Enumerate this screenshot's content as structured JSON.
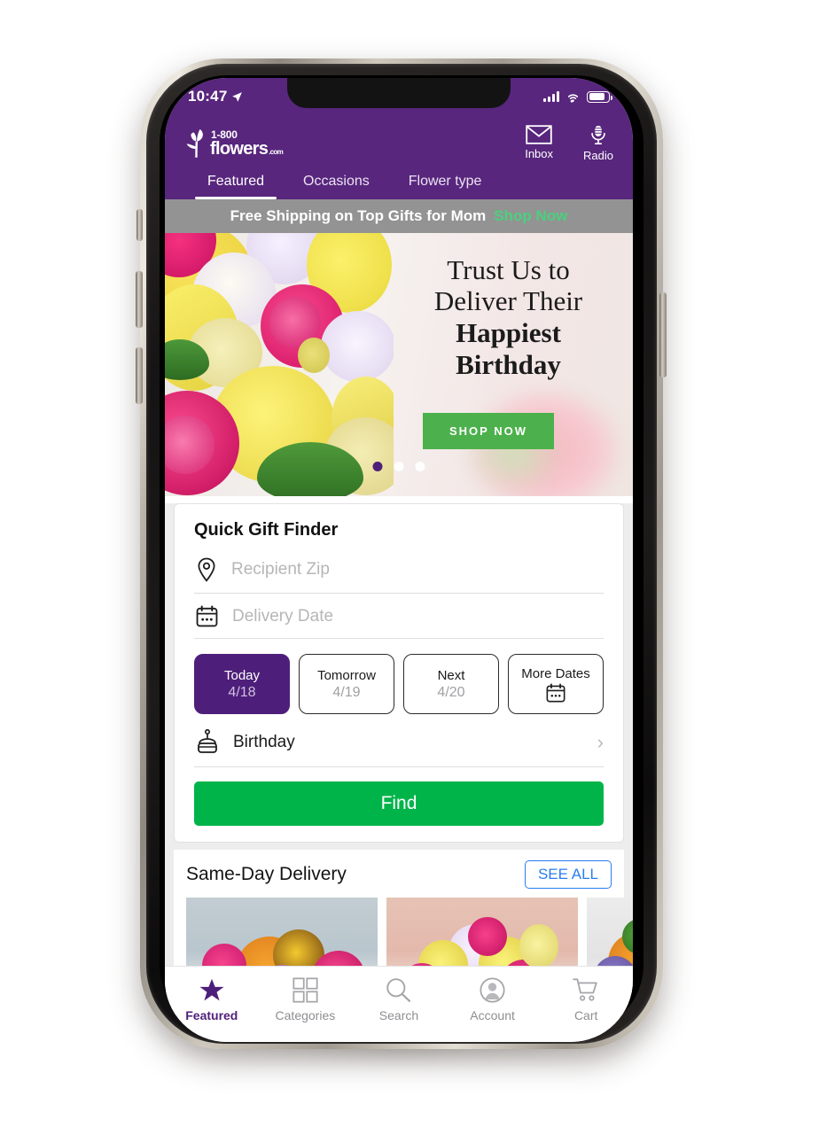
{
  "status_bar": {
    "time": "10:47",
    "location_icon": "location-arrow-icon",
    "signal_icon": "cellular-signal-icon",
    "wifi_icon": "wifi-icon",
    "battery_icon": "battery-icon"
  },
  "header": {
    "brand": {
      "line1": "1-800",
      "line2": "flowers",
      "suffix": ".com",
      "logo_icon": "tulip-logo-icon"
    },
    "actions": [
      {
        "label": "Inbox",
        "icon": "envelope-icon"
      },
      {
        "label": "Radio",
        "icon": "microphone-icon"
      }
    ],
    "tabs": [
      {
        "label": "Featured",
        "active": true
      },
      {
        "label": "Occasions",
        "active": false
      },
      {
        "label": "Flower type",
        "active": false
      }
    ],
    "accent_purple": "#58267D"
  },
  "promo": {
    "text": "Free Shipping on Top Gifts for Mom",
    "cta": "Shop Now",
    "bg": "#939393",
    "cta_color": "#4ad07e"
  },
  "hero": {
    "line1": "Trust Us to",
    "line2": "Deliver Their",
    "line3": "Happiest",
    "line4": "Birthday",
    "button": "SHOP NOW",
    "button_color": "#4cb14c",
    "dots": 3,
    "active_dot": 1
  },
  "gift_finder": {
    "title": "Quick Gift Finder",
    "zip": {
      "placeholder": "Recipient Zip",
      "value": "",
      "icon": "location-pin-icon"
    },
    "date": {
      "placeholder": "Delivery Date",
      "value": "",
      "icon": "calendar-icon"
    },
    "chips": [
      {
        "label": "Today",
        "date": "4/18",
        "selected": true
      },
      {
        "label": "Tomorrow",
        "date": "4/19",
        "selected": false
      },
      {
        "label": "Next",
        "date": "4/20",
        "selected": false
      },
      {
        "label": "More Dates",
        "date": "",
        "selected": false,
        "icon": "calendar-icon"
      }
    ],
    "occasion": {
      "label": "Birthday",
      "icon": "birthday-cake-icon",
      "chevron": "chevron-right-icon"
    },
    "find_button": "Find",
    "find_color": "#00b44a",
    "selected_chip_color": "#4e1f7a"
  },
  "same_day": {
    "title": "Same-Day Delivery",
    "see_all": "SEE ALL",
    "see_all_color": "#2a7df0",
    "products": [
      {
        "name": "sunflower-and-lily-bouquet"
      },
      {
        "name": "yellow-lily-and-rose-bouquet"
      },
      {
        "name": "mixed-spring-bouquet"
      }
    ]
  },
  "tab_bar": {
    "items": [
      {
        "label": "Featured",
        "icon": "star-icon",
        "active": true
      },
      {
        "label": "Categories",
        "icon": "grid-icon",
        "active": false
      },
      {
        "label": "Search",
        "icon": "magnifier-icon",
        "active": false
      },
      {
        "label": "Account",
        "icon": "person-circle-icon",
        "active": false
      },
      {
        "label": "Cart",
        "icon": "shopping-cart-icon",
        "active": false
      }
    ],
    "active_color": "#4e1f7a",
    "inactive_color": "#8e8e93"
  }
}
